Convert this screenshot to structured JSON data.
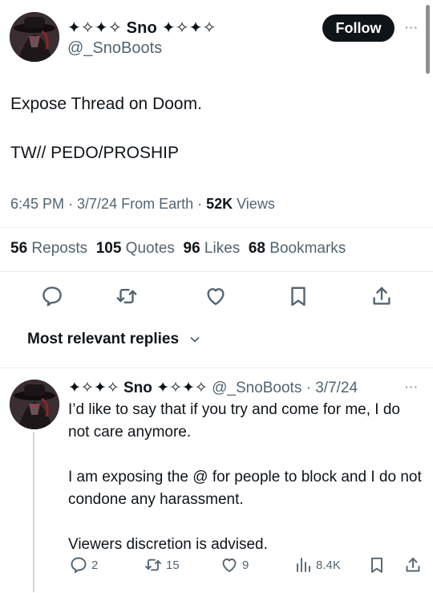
{
  "tweet": {
    "display_name": "✦✧✦✧ Sno ✦✧✦✧",
    "handle": "@_SnoBoots",
    "follow_label": "Follow",
    "more_label": "···",
    "text_line1": "Expose Thread on Doom.",
    "text_line2": "TW// PEDO/PROSHIP",
    "time_date": "6:45 PM · 3/7/24 From Earth · ",
    "views_count": "52K",
    "views_label": " Views",
    "reposts_count": "56",
    "reposts_label": "Reposts",
    "quotes_count": "105",
    "quotes_label": "Quotes",
    "likes_count": "96",
    "likes_label": "Likes",
    "bookmarks_count": "68",
    "bookmarks_label": "Bookmarks"
  },
  "replies_sort": {
    "label": "Most relevant replies"
  },
  "reply": {
    "display_name": "✦✧✦✧ Sno ✦✧✦✧",
    "handle_date": "@_SnoBoots · 3/7/24",
    "more_label": "···",
    "paragraph1": "I’d like to say that if you try and come for me, I do not care anymore.",
    "paragraph2": "I am exposing the @ for people to block and I do not condone any harassment.",
    "paragraph3": "Viewers discretion is advised.",
    "reply_count": "2",
    "repost_count": "15",
    "like_count": "9",
    "views_count": "8.4K"
  },
  "colors": {
    "text_primary": "#0f1419",
    "text_secondary": "#536471",
    "divider": "#e6ecf0",
    "follow_bg": "#0f1419"
  },
  "icons": {
    "actions": [
      "reply-icon",
      "repost-icon",
      "like-icon",
      "bookmark-icon",
      "share-icon"
    ],
    "sort": "chevron-down-icon",
    "views": "views-chart-icon"
  }
}
